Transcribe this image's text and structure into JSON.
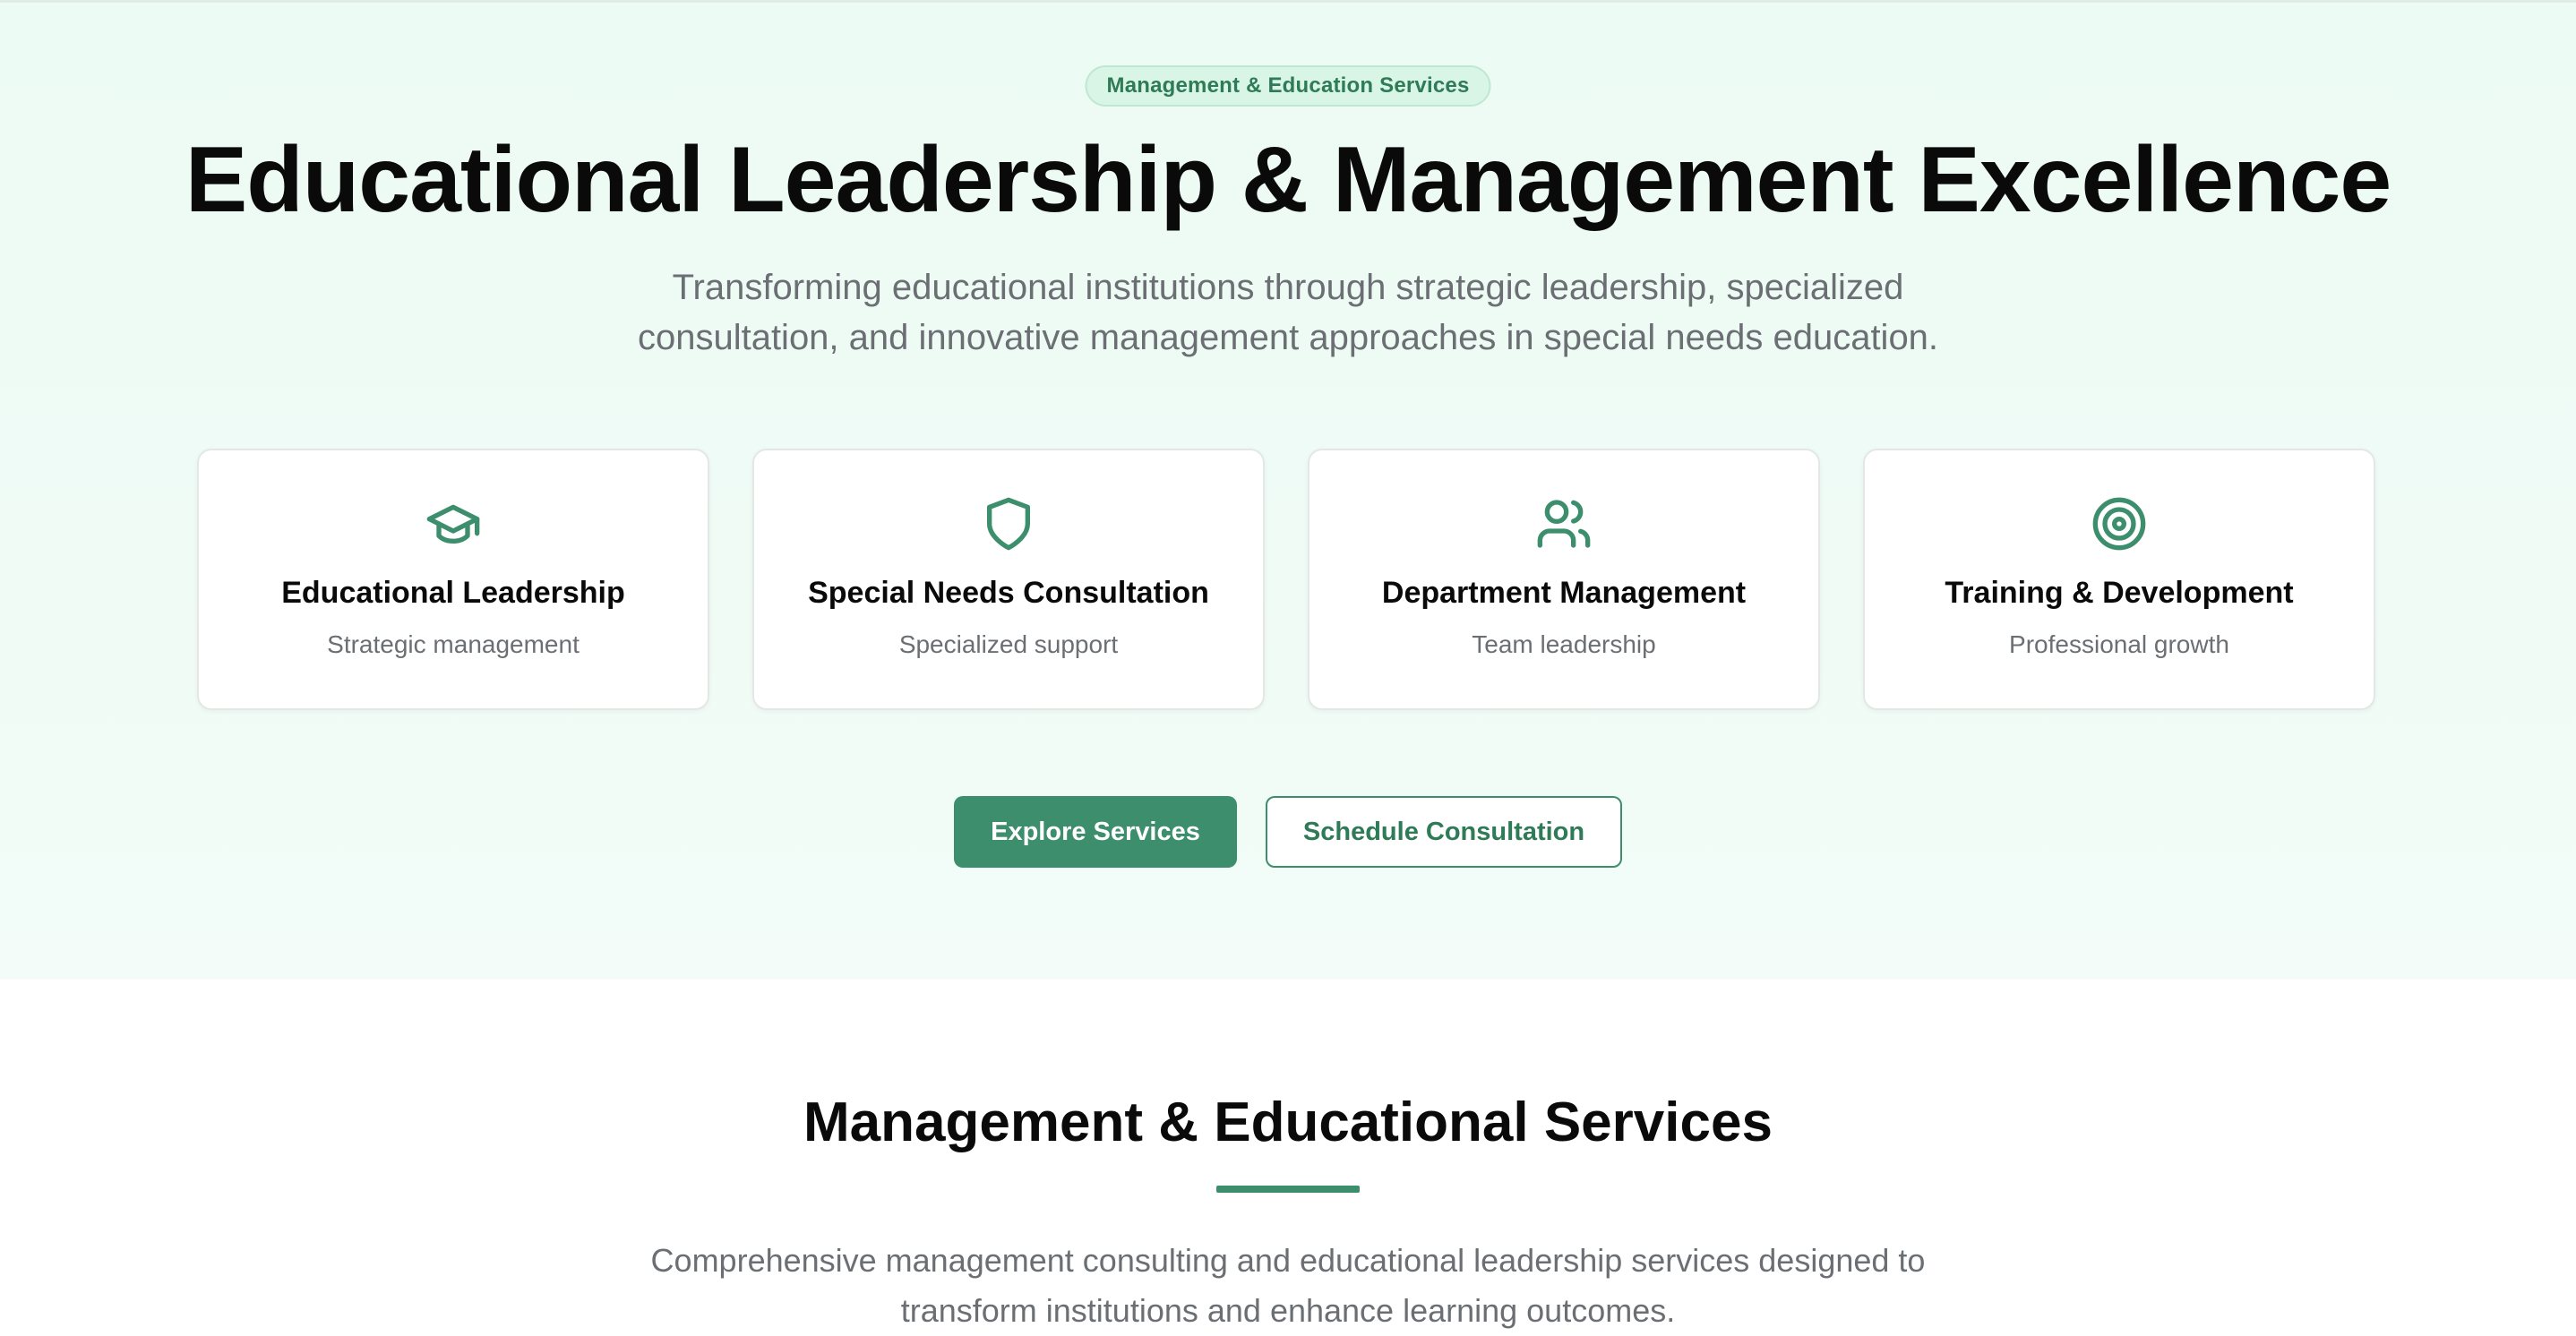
{
  "hero": {
    "badge": "Management & Education Services",
    "title": "Educational Leadership & Management Excellence",
    "subtitle": "Transforming educational institutions through strategic leadership, specialized consultation, and innovative management approaches in special needs education.",
    "cards": [
      {
        "icon": "graduation-cap-icon",
        "title": "Educational Leadership",
        "subtitle": "Strategic management"
      },
      {
        "icon": "shield-icon",
        "title": "Special Needs Consultation",
        "subtitle": "Specialized support"
      },
      {
        "icon": "users-icon",
        "title": "Department Management",
        "subtitle": "Team leadership"
      },
      {
        "icon": "target-icon",
        "title": "Training & Development",
        "subtitle": "Professional growth"
      }
    ],
    "primary_button": "Explore Services",
    "secondary_button": "Schedule Consultation"
  },
  "services": {
    "title": "Management & Educational Services",
    "subtitle": "Comprehensive management consulting and educational leadership services designed to transform institutions and enhance learning outcomes."
  },
  "colors": {
    "accent": "#3d8e6c",
    "hero_background": "#ecfbf4",
    "badge_background": "#d8f5e6",
    "text_muted": "#6b6f73"
  }
}
